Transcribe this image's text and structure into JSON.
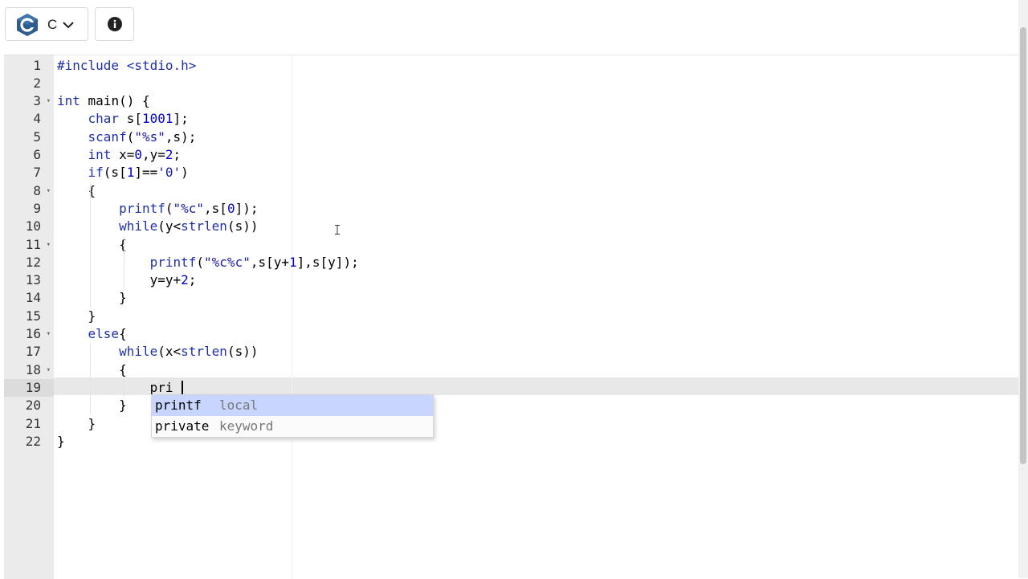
{
  "toolbar": {
    "language": "C",
    "language_icon": "c-language-logo-icon",
    "dropdown_icon": "chevron-down-icon",
    "info_icon": "info-icon"
  },
  "editor": {
    "active_line": 19,
    "lines": [
      {
        "n": "1",
        "fold": false,
        "tokens": [
          {
            "t": "#include <stdio.h>",
            "c": "kw"
          }
        ]
      },
      {
        "n": "2",
        "fold": false,
        "tokens": []
      },
      {
        "n": "3",
        "fold": true,
        "tokens": [
          {
            "t": "int",
            "c": "kw"
          },
          {
            "t": " main() {",
            "c": ""
          }
        ]
      },
      {
        "n": "4",
        "fold": false,
        "tokens": [
          {
            "t": "    ",
            "c": ""
          },
          {
            "t": "char",
            "c": "kw"
          },
          {
            "t": " s[",
            "c": ""
          },
          {
            "t": "1001",
            "c": "num-c"
          },
          {
            "t": "];",
            "c": ""
          }
        ]
      },
      {
        "n": "5",
        "fold": false,
        "tokens": [
          {
            "t": "    ",
            "c": ""
          },
          {
            "t": "scanf",
            "c": "kw"
          },
          {
            "t": "(",
            "c": ""
          },
          {
            "t": "\"%s\"",
            "c": "str"
          },
          {
            "t": ",s);",
            "c": ""
          }
        ]
      },
      {
        "n": "6",
        "fold": false,
        "tokens": [
          {
            "t": "    ",
            "c": ""
          },
          {
            "t": "int",
            "c": "kw"
          },
          {
            "t": " x=",
            "c": ""
          },
          {
            "t": "0",
            "c": "num-c"
          },
          {
            "t": ",y=",
            "c": ""
          },
          {
            "t": "2",
            "c": "num-c"
          },
          {
            "t": ";",
            "c": ""
          }
        ]
      },
      {
        "n": "7",
        "fold": false,
        "tokens": [
          {
            "t": "    ",
            "c": ""
          },
          {
            "t": "if",
            "c": "kw"
          },
          {
            "t": "(s[",
            "c": ""
          },
          {
            "t": "1",
            "c": "num-c"
          },
          {
            "t": "]==",
            "c": ""
          },
          {
            "t": "'0'",
            "c": "str"
          },
          {
            "t": ")",
            "c": ""
          }
        ]
      },
      {
        "n": "8",
        "fold": true,
        "tokens": [
          {
            "t": "    {",
            "c": ""
          }
        ]
      },
      {
        "n": "9",
        "fold": false,
        "tokens": [
          {
            "t": "        ",
            "c": ""
          },
          {
            "t": "printf",
            "c": "kw"
          },
          {
            "t": "(",
            "c": ""
          },
          {
            "t": "\"%c\"",
            "c": "str"
          },
          {
            "t": ",s[",
            "c": ""
          },
          {
            "t": "0",
            "c": "num-c"
          },
          {
            "t": "]);",
            "c": ""
          }
        ]
      },
      {
        "n": "10",
        "fold": false,
        "tokens": [
          {
            "t": "        ",
            "c": ""
          },
          {
            "t": "while",
            "c": "kw"
          },
          {
            "t": "(y<",
            "c": ""
          },
          {
            "t": "strlen",
            "c": "kw"
          },
          {
            "t": "(s))",
            "c": ""
          }
        ]
      },
      {
        "n": "11",
        "fold": true,
        "tokens": [
          {
            "t": "        {",
            "c": ""
          }
        ]
      },
      {
        "n": "12",
        "fold": false,
        "tokens": [
          {
            "t": "            ",
            "c": ""
          },
          {
            "t": "printf",
            "c": "kw"
          },
          {
            "t": "(",
            "c": ""
          },
          {
            "t": "\"%c%c\"",
            "c": "str"
          },
          {
            "t": ",s[y+",
            "c": ""
          },
          {
            "t": "1",
            "c": "num-c"
          },
          {
            "t": "],s[y]);",
            "c": ""
          }
        ]
      },
      {
        "n": "13",
        "fold": false,
        "tokens": [
          {
            "t": "            y=y+",
            "c": ""
          },
          {
            "t": "2",
            "c": "num-c"
          },
          {
            "t": ";",
            "c": ""
          }
        ]
      },
      {
        "n": "14",
        "fold": false,
        "tokens": [
          {
            "t": "        }",
            "c": ""
          }
        ]
      },
      {
        "n": "15",
        "fold": false,
        "tokens": [
          {
            "t": "    }",
            "c": ""
          }
        ]
      },
      {
        "n": "16",
        "fold": true,
        "tokens": [
          {
            "t": "    ",
            "c": ""
          },
          {
            "t": "else",
            "c": "kw"
          },
          {
            "t": "{",
            "c": ""
          }
        ]
      },
      {
        "n": "17",
        "fold": false,
        "tokens": [
          {
            "t": "        ",
            "c": ""
          },
          {
            "t": "while",
            "c": "kw"
          },
          {
            "t": "(x<",
            "c": ""
          },
          {
            "t": "strlen",
            "c": "kw"
          },
          {
            "t": "(s))",
            "c": ""
          }
        ]
      },
      {
        "n": "18",
        "fold": true,
        "tokens": [
          {
            "t": "        {",
            "c": ""
          }
        ]
      },
      {
        "n": "19",
        "fold": false,
        "tokens": [
          {
            "t": "            pri",
            "c": ""
          }
        ]
      },
      {
        "n": "20",
        "fold": false,
        "tokens": [
          {
            "t": "        }",
            "c": ""
          }
        ]
      },
      {
        "n": "21",
        "fold": false,
        "tokens": [
          {
            "t": "    }",
            "c": ""
          }
        ]
      },
      {
        "n": "22",
        "fold": false,
        "tokens": [
          {
            "t": "}",
            "c": ""
          }
        ]
      }
    ]
  },
  "autocomplete": {
    "items": [
      {
        "value": "printf",
        "meta": "local",
        "selected": true
      },
      {
        "value": "private",
        "meta": "keyword",
        "selected": false
      }
    ]
  }
}
